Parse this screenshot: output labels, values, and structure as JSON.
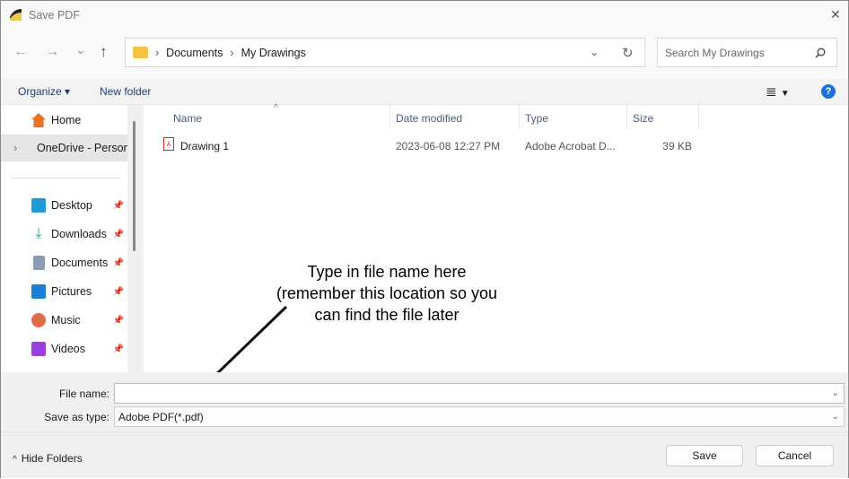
{
  "window": {
    "title": "Save PDF",
    "close": "✕"
  },
  "nav": {
    "back": "←",
    "forward": "→",
    "recent": "⌄",
    "up": "↑",
    "breadcrumb": [
      "Documents",
      "My Drawings"
    ],
    "sep": "›",
    "refresh": "↻",
    "dropdown": "⌄",
    "search_placeholder": "Search My Drawings"
  },
  "toolbar": {
    "organize": "Organize",
    "new_folder": "New folder",
    "view": "≣",
    "help": "?"
  },
  "sidebar": {
    "items": [
      {
        "label": "Home",
        "color": "#e8742a"
      },
      {
        "label": "OneDrive - Personal",
        "color": "#f5c242"
      }
    ],
    "quick": [
      {
        "label": "Desktop",
        "color": "#1e9ad6"
      },
      {
        "label": "Downloads",
        "color": "#1aa38a"
      },
      {
        "label": "Documents",
        "color": "#8a9bb5"
      },
      {
        "label": "Pictures",
        "color": "#1b7fd6"
      },
      {
        "label": "Music",
        "color": "#e06a4a"
      },
      {
        "label": "Videos",
        "color": "#9b3ee0"
      }
    ]
  },
  "list": {
    "columns": [
      "Name",
      "Date modified",
      "Type",
      "Size"
    ],
    "rows": [
      {
        "name": "Drawing 1",
        "date": "2023-06-08 12:27 PM",
        "type": "Adobe Acrobat D...",
        "size": "39 KB"
      }
    ]
  },
  "form": {
    "file_name_label": "File name:",
    "file_name_value": "",
    "type_label": "Save as type:",
    "type_value": "Adobe PDF(*.pdf)"
  },
  "footer": {
    "hide_folders": "Hide Folders",
    "save": "Save",
    "cancel": "Cancel"
  },
  "annotation": {
    "text": "Type in file name here (remember this location so you can find the file later"
  }
}
